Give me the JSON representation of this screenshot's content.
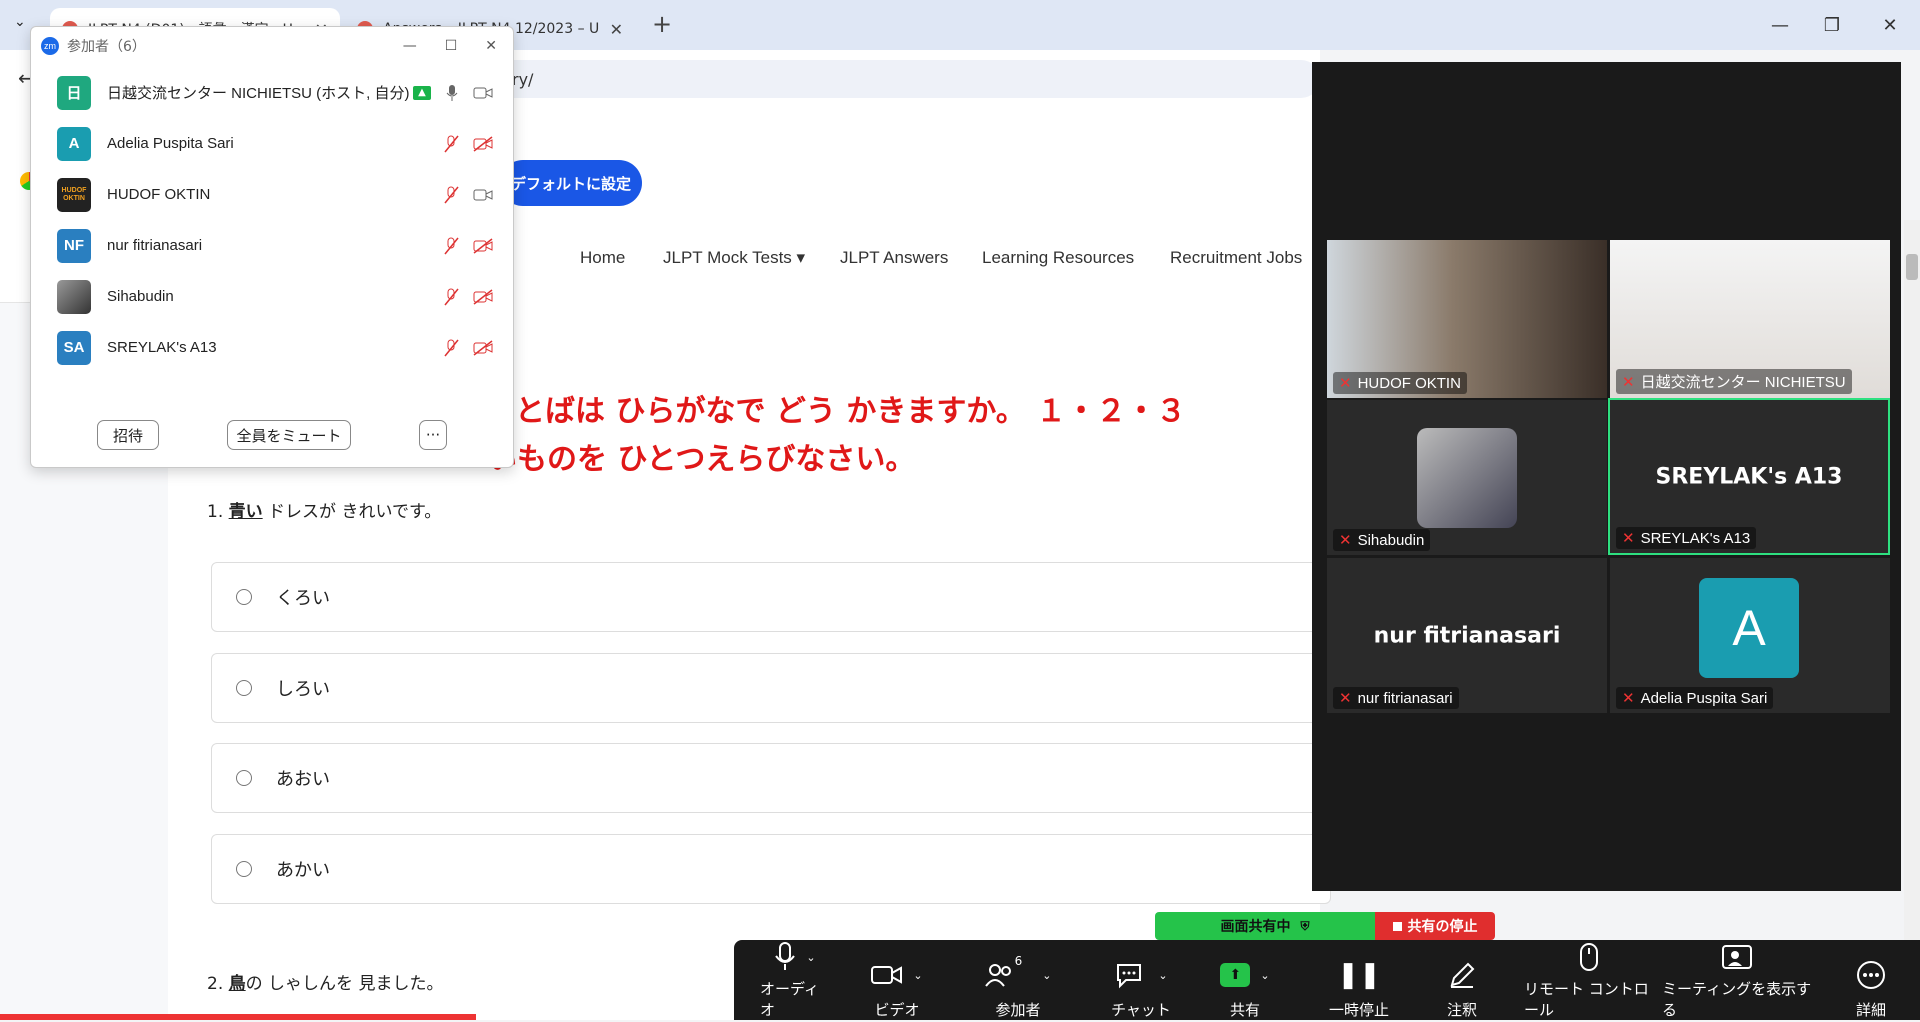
{
  "browser": {
    "tabs": [
      {
        "label": "JLPT N4 (D01) - 語彙・漢字 - Un"
      },
      {
        "label": "Answers – JLPT N4 12/2023 – U"
      }
    ],
    "new_tab": "+",
    "url_fragment": "ry/",
    "controls": {
      "minimize": "—",
      "restore": "❐",
      "close": "✕"
    }
  },
  "page": {
    "default_button": "デフォルトに設定",
    "nav": [
      "Home",
      "JLPT Mock Tests ▾",
      "JLPT Answers",
      "Learning Resources",
      "Recruitment Jobs"
    ],
    "instruction_line1": "のことばは ひらがなで どう かきますか。 １・２・３",
    "instruction_line2": "いものを ひとつえらびなさい。",
    "question1": {
      "num": "1.",
      "underlined": "青い",
      "rest": " ドレスが きれいです。"
    },
    "choices": [
      "くろい",
      "しろい",
      "あおい",
      "あかい"
    ],
    "question2": {
      "num": "2.",
      "underlined": "鳥",
      "rest": "の しゃしんを 見ました。"
    }
  },
  "participants": {
    "title": "参加者（6）",
    "rows": [
      {
        "initial": "日",
        "name": "日越交流センター NICHIETSU (ホスト, 自分)",
        "color": "#1fa87f"
      },
      {
        "initial": "A",
        "name": "Adelia Puspita Sari",
        "color": "#1a9db0"
      },
      {
        "initial": "HUDOF OKTIN",
        "name": "HUDOF OKTIN",
        "color": "#222222"
      },
      {
        "initial": "NF",
        "name": "nur fitrianasari",
        "color": "#2a7fc0"
      },
      {
        "initial": "",
        "name": "Sihabudin",
        "color": "#666666"
      },
      {
        "initial": "SA",
        "name": "SREYLAK's A13",
        "color": "#2a7fc0"
      }
    ],
    "buttons": {
      "invite": "招待",
      "mute_all": "全員をミュート",
      "more": "···"
    }
  },
  "gallery": {
    "tiles": [
      {
        "name": "HUDOF OKTIN"
      },
      {
        "name": "日越交流センター NICHIETSU"
      },
      {
        "name": "Sihabudin"
      },
      {
        "name": "SREYLAK's A13",
        "big": "SREYLAK's A13"
      },
      {
        "name": "nur fitrianasari",
        "big": "nur fitrianasari"
      },
      {
        "name": "Adelia Puspita Sari",
        "avatar": "A"
      }
    ]
  },
  "share_bar": {
    "status": "画面共有中",
    "stop": "共有の停止"
  },
  "toolbar": {
    "audio": "オーディオ",
    "video": "ビデオ",
    "participants": "参加者",
    "participants_count": "6",
    "chat": "チャット",
    "share": "共有",
    "pause": "一時停止",
    "annotate": "注釈",
    "remote": "リモート コントロール",
    "show_meeting": "ミーティングを表示する",
    "more": "詳細"
  },
  "colors": {
    "accent": "#1a57e6",
    "title_red": "#e01818",
    "active_green": "#2ecc71",
    "stop_red": "#e02e2e"
  }
}
